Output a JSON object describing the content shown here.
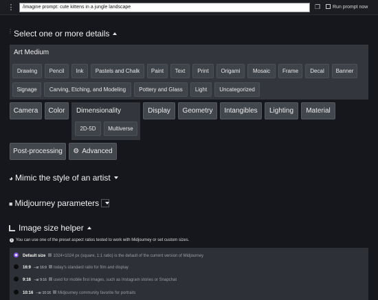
{
  "topbar": {
    "prompt_value": "/imagine prompt: cute kittens in a jungle landscape",
    "run_label": "Run prompt now"
  },
  "sections": {
    "details_title": "Select one or more details",
    "artist_title": "Mimic the style of an artist",
    "params_title": "Midjourney parameters",
    "size_title": "Image size helper"
  },
  "art_medium": {
    "title": "Art Medium",
    "items": [
      "Drawing",
      "Pencil",
      "Ink",
      "Pastels and Chalk",
      "Paint",
      "Text",
      "Print",
      "Origami",
      "Mosaic",
      "Frame",
      "Decal",
      "Banner",
      "Signage",
      "Carving, Etching, and Modeling",
      "Pottery and Glass",
      "Light",
      "Uncategorized"
    ]
  },
  "categories": [
    "Camera",
    "Color",
    "Dimensionality",
    "Display",
    "Geometry",
    "Intangibles",
    "Lighting",
    "Material",
    "Post-processing",
    "Advanced"
  ],
  "dimensionality_items": [
    "2D-5D",
    "Multiverse"
  ],
  "size_helper": {
    "info": "You can use one of the preset aspect ratios tested to work with Midjourney or set custom sizes.",
    "options": [
      {
        "label": "Default size",
        "code": "",
        "desc": "1024×1024 px (square, 1:1 ratio) is the default of the current version of Midjourney",
        "selected": true
      },
      {
        "label": "16:9",
        "code": "--ar 16:9",
        "desc": "today's standard ratio for film and display",
        "selected": false
      },
      {
        "label": "9:16",
        "code": "--ar 9:16",
        "desc": "used for mobile first images, such as Instagram stories or Snapchat",
        "selected": false
      },
      {
        "label": "10:16",
        "code": "--ar 10:16",
        "desc": "Midjourney community favorite for portraits",
        "selected": false
      }
    ]
  },
  "colors": {
    "background": "#16171c",
    "panel": "#33363c",
    "chip": "#3f434a",
    "radio_accent": "#8d5cf5"
  }
}
